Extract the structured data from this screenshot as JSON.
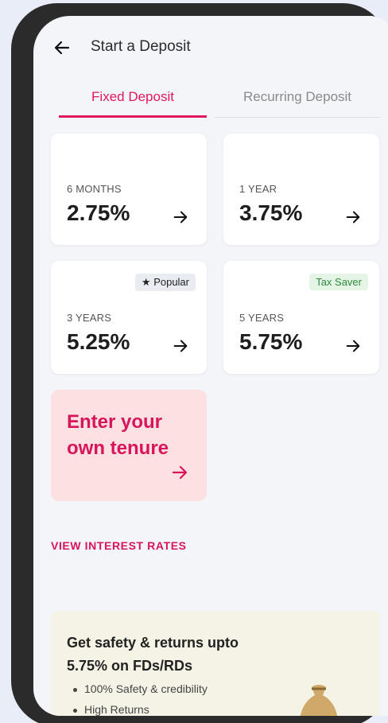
{
  "header": {
    "title": "Start a Deposit",
    "back_icon": "arrow-left-icon"
  },
  "tabs": [
    {
      "label": "Fixed Deposit",
      "active": true
    },
    {
      "label": "Recurring Deposit",
      "active": false
    }
  ],
  "cards": [
    {
      "tenure": "6 MONTHS",
      "rate": "2.75%",
      "badge": null
    },
    {
      "tenure": "1 YEAR",
      "rate": "3.75%",
      "badge": null
    },
    {
      "tenure": "3 YEARS",
      "rate": "5.25%",
      "badge": "Popular",
      "badge_icon": "star-icon"
    },
    {
      "tenure": "5 YEARS",
      "rate": "5.75%",
      "badge": "Tax Saver"
    }
  ],
  "own_tenure": {
    "label": "Enter your own tenure"
  },
  "view_rates_label": "VIEW INTEREST RATES",
  "promo": {
    "headline": "Get safety & returns upto 5.75% on FDs/RDs",
    "bullets": [
      "100% Safety & credibility",
      "High Returns"
    ]
  },
  "colors": {
    "accent": "#d8155b",
    "screen_bg": "#f4f5f9",
    "promo_bg": "#f5f3e6",
    "own_card_bg": "#fde1e2"
  }
}
